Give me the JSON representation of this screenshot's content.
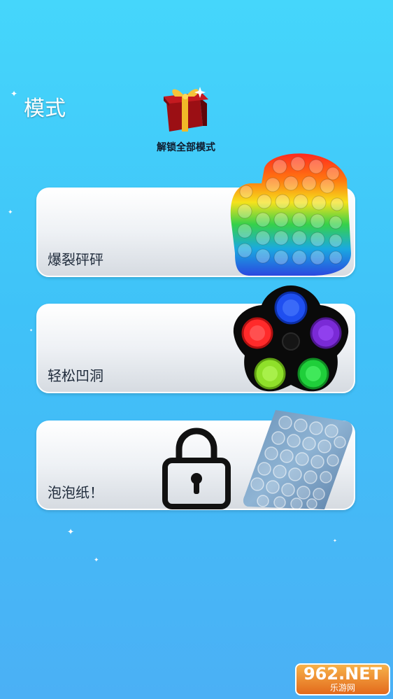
{
  "header": {
    "title": "模式"
  },
  "unlock": {
    "label": "解锁全部模式"
  },
  "modes": [
    {
      "label": "爆裂砰砰",
      "locked": false,
      "icon": "rainbow-popit-icon"
    },
    {
      "label": "轻松凹洞",
      "locked": false,
      "icon": "popit-spinner-icon"
    },
    {
      "label": "泡泡纸！",
      "locked": true,
      "icon": "bubble-wrap-icon"
    }
  ],
  "watermark": {
    "main": "962.NET",
    "sub": "乐游网"
  },
  "colors": {
    "background_top": "#45d6fb",
    "background_bottom": "#4bb0f5",
    "card_text": "#1e2a3a",
    "spinner_blue": "#1f4ff0",
    "spinner_purple": "#7a2ad6",
    "spinner_green": "#1fcf3a",
    "spinner_lime": "#8fe02a",
    "spinner_red": "#ff2a2a"
  }
}
